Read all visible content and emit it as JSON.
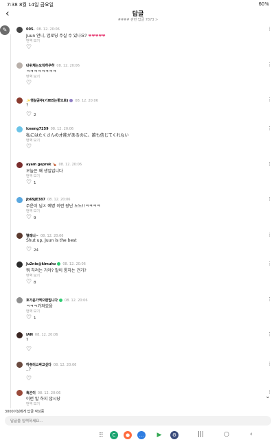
{
  "status": {
    "left": "7:38  8월 14일 금요일",
    "right": "60%"
  },
  "header": {
    "title": "답글",
    "subtitle": "#### 관련 답글 7873 >"
  },
  "comments": [
    {
      "user": "005.",
      "date": "08. 12. 20:06",
      "text": "Juun 언니, 업로딩 주실 수 있나요? ",
      "hearts": "❤❤❤❤❤",
      "translate": "번역 보기",
      "likes": ""
    },
    {
      "user": "내쉬체는오직하우하",
      "date": "08. 12. 20:06",
      "text": "ㅋㅋㅋㅋㅋㅋㅋㅋ",
      "translate": "번역 보기",
      "likes": ""
    },
    {
      "user": "✨햇살공주(기쁘와는좋으로)",
      "date": "08. 12. 20:06",
      "text": "?",
      "translate": "",
      "likes": "2"
    },
    {
      "user": "loseng7259",
      "date": "08. 12. 20:06",
      "text": "私にはたくさんの才能があるのに、誰も信じてくれない",
      "translate": "번역 보기",
      "likes": ""
    },
    {
      "user": "ayam geprek 🍗",
      "date": "08. 12. 20:06",
      "text": "오늘은 왜 생일입니다",
      "translate": "번역 보기",
      "likes": "1"
    },
    {
      "user": "jb69JE387",
      "date": "08. 12. 20:06",
      "text": "주운이 님ㅈ 예명 이런 장난 노노!!ㅋㅋㅋㅋ",
      "translate": "번역 보기",
      "likes": "9"
    },
    {
      "user": "별레니~",
      "date": "08. 12. 20:06",
      "text": "Shut up, Juun is the best",
      "translate": "",
      "likes": "24"
    },
    {
      "user": "Ju2nie@kimuho",
      "date": "08. 12. 20:06",
      "text": "뭐 하려는 거야? 말이 통하는 건가?",
      "translate": "번역 보기",
      "likes": "8"
    },
    {
      "user": "호가운가멕으편입니다",
      "date": "08. 12. 20:06",
      "text": "ㅋㅋㅋ가져갔음",
      "translate": "번역 보기",
      "likes": "1"
    },
    {
      "user": "IAN",
      "date": "08. 12. 20:06",
      "text": "?",
      "translate": "",
      "likes": ""
    },
    {
      "user": "하츄러스박고싶다",
      "date": "08. 12. 20:06",
      "text": "..?",
      "translate": "",
      "likes": ""
    },
    {
      "user": "흑곤이",
      "date": "08. 12. 20:06",
      "text": "이런 말 하지 않시당",
      "translate": "번역 보기",
      "likes": ""
    }
  ],
  "footer": {
    "reply_info": "3000이님에게 답글 작성중",
    "input_placeholder": "답글을 입력하세요..."
  },
  "colors": {
    "heart_pink": "#e8457a",
    "verified": "#2ecc71"
  }
}
